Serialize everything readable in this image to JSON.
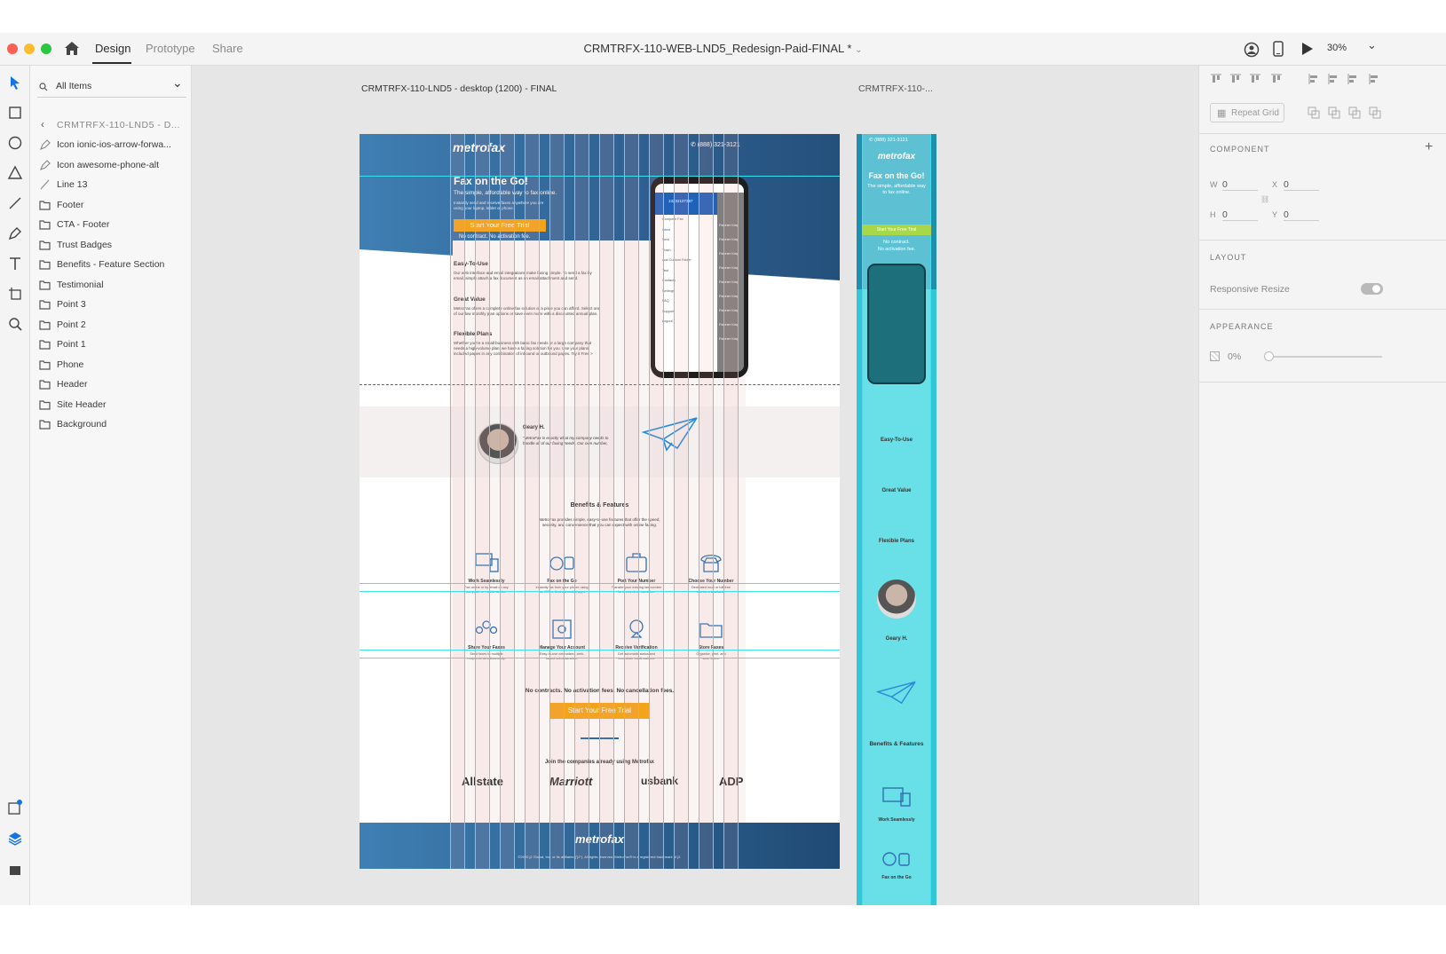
{
  "topbar": {
    "tabs": [
      "Design",
      "Prototype",
      "Share"
    ],
    "doc_title": "CRMTRFX-110-WEB-LND5_Redesign-Paid-FINAL *",
    "zoom": "30%"
  },
  "layers": {
    "search_label": "All Items",
    "back_label": "CRMTRFX-110-LND5 - D...",
    "items": [
      {
        "label": "Icon ionic-ios-arrow-forwa...",
        "type": "symbol"
      },
      {
        "label": "Icon awesome-phone-alt",
        "type": "symbol"
      },
      {
        "label": "Line 13",
        "type": "line"
      },
      {
        "label": "Footer",
        "type": "folder"
      },
      {
        "label": "CTA - Footer",
        "type": "folder"
      },
      {
        "label": "Trust Badges",
        "type": "folder"
      },
      {
        "label": "Benefits - Feature Section",
        "type": "folder"
      },
      {
        "label": "Testimonial",
        "type": "folder"
      },
      {
        "label": "Point 3",
        "type": "folder"
      },
      {
        "label": "Point 2",
        "type": "folder"
      },
      {
        "label": "Point 1",
        "type": "folder"
      },
      {
        "label": "Phone",
        "type": "folder"
      },
      {
        "label": "Header",
        "type": "folder"
      },
      {
        "label": "Site Header",
        "type": "folder"
      },
      {
        "label": "Background",
        "type": "folder"
      }
    ]
  },
  "canvas": {
    "artboard_label": "CRMTRFX-110-LND5 - desktop (1200) - FINAL",
    "mobile_label": "CRMTRFX-110-..."
  },
  "desktop": {
    "logo": "metrofax",
    "phone": "(888) 321-3121",
    "hero_title": "Fax on the Go!",
    "hero_sub": "The simple, affordable way to fax online.",
    "hero_body1": "Instantly send and receive faxes anywhere you are",
    "hero_body2": "using your laptop, tablet or phone.",
    "cta": "Start Your Free Trial",
    "no_contract": "No contract. No activation fee.",
    "points": [
      {
        "title": "Easy-To-Use",
        "lines": [
          "Our web interface and email integrations make faxing simple. To send a fax by",
          "email, simply attach a fax document as an email attachment and send."
        ]
      },
      {
        "title": "Great Value",
        "lines": [
          "MetroFax offers a complete online fax solution at a price you can afford. Select one",
          "of our low monthly plan options or save even more with a discounted annual plan."
        ]
      },
      {
        "title": "Flexible Plans",
        "lines": [
          "Whether you're a small business with basic fax needs or a large company that",
          "needs a high-volume plan, we have a faxing solution for you. Use your plans",
          "included pages in any combination of inbound or outbound pages. Try it Free >"
        ]
      }
    ],
    "phone_number_screen": "13232107397",
    "phone_menu": [
      "Compose Fax",
      "Inbox",
      "Sent",
      "Trash",
      "Add Custom Folder",
      "Test",
      "Contacts",
      "Settings",
      "FAQ",
      "Support",
      "Logout"
    ],
    "phone_sender": "Fischer King",
    "testimonial_name": "Geary H.",
    "testimonial_quote1": "\"MetroFax is exactly what my company needs to",
    "testimonial_quote2": "handle all of our faxing needs. Our own number,",
    "benefits_title": "Benefits & Features",
    "benefits_body1": "MetroFax provides simple, easy-to-use features that offer the speed,",
    "benefits_body2": "security, and convenience that you can expect with online faxing.",
    "features": [
      {
        "title": "Work Seamlessly",
        "lines": [
          "Fax online or by email on any",
          "computer or mobile device."
        ]
      },
      {
        "title": "Fax on the Go",
        "lines": [
          "Instantly fax from your phone using",
          "our iOS or Android mobile apps"
        ]
      },
      {
        "title": "Port Your Number",
        "lines": [
          "Transfer your existing fax number",
          "for a seamless transition."
        ]
      },
      {
        "title": "Choose Your Number",
        "lines": [
          "Dedicated local or toll-free",
          "numbers available."
        ]
      },
      {
        "title": "Share Your Faxes",
        "lines": [
          "Send faxes to multiple",
          "recipients simultaneously."
        ]
      },
      {
        "title": "Manage Your Account",
        "lines": [
          "Easy-to-use centralized, web-",
          "based administration."
        ]
      },
      {
        "title": "Receive Verification",
        "lines": [
          "Get automatic status and",
          "immediate confirmations."
        ]
      },
      {
        "title": "Store Faxes",
        "lines": [
          "Organize, print, and",
          "save faxes."
        ]
      }
    ],
    "no_contracts": "No contracts. No activation fees. No cancellation fees.",
    "join": "Join the companies already using Metrofax",
    "badges": [
      "Allstate",
      "Marriott",
      "usbank",
      "ADP"
    ],
    "footer_copy": "©2020 j2 Global, Inc. or its affiliates (\"j2\"). All rights reserved. MetroFax® is a registered trademark of j2."
  },
  "mobile": {
    "phone": "(888) 321-3121",
    "logo": "metrofax",
    "hero_title": "Fax on the Go!",
    "hero_sub": "The simple, affordable way to fax online.",
    "cta": "Start Your Free Trial",
    "no_contract": "No contract.",
    "no_activation": "No activation fee.",
    "points": [
      "Easy-To-Use",
      "Great Value",
      "Flexible Plans"
    ],
    "testimonial_name": "Geary H.",
    "benefits_title": "Benefits & Features",
    "features": [
      "Work Seamlessly",
      "Fax on the Go"
    ]
  },
  "props": {
    "repeat_grid": "Repeat Grid",
    "component": "COMPONENT",
    "w_label": "W",
    "w": "0",
    "h_label": "H",
    "h": "0",
    "x_label": "X",
    "x": "0",
    "y_label": "Y",
    "y": "0",
    "layout": "LAYOUT",
    "responsive_resize": "Responsive Resize",
    "appearance": "APPEARANCE",
    "opacity": "0%"
  },
  "colors": {
    "accent": "#1473e6",
    "guide": "#3fe0f0",
    "cta": "#f2a41c",
    "hero_blue": "#2f5f8f"
  }
}
